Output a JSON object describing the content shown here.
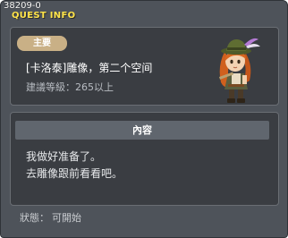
{
  "window": {
    "quest_id": "38209-0",
    "title": "QUEST INFO"
  },
  "quest": {
    "badge": "主要",
    "name": "[卡洛泰]雕像，第二个空间",
    "level_requirement": "建議等級：265以上",
    "npc_icon": "green-hat-adventurer-npc"
  },
  "content": {
    "header": "內容",
    "lines": [
      "我做好准备了。",
      "去雕像跟前看看吧。"
    ]
  },
  "status": {
    "label": "狀態：",
    "value": "可開始"
  },
  "colors": {
    "title": "#ffe44a",
    "badge": "#c9b086",
    "panel": "#3a3d42",
    "window": "#4e535a"
  }
}
